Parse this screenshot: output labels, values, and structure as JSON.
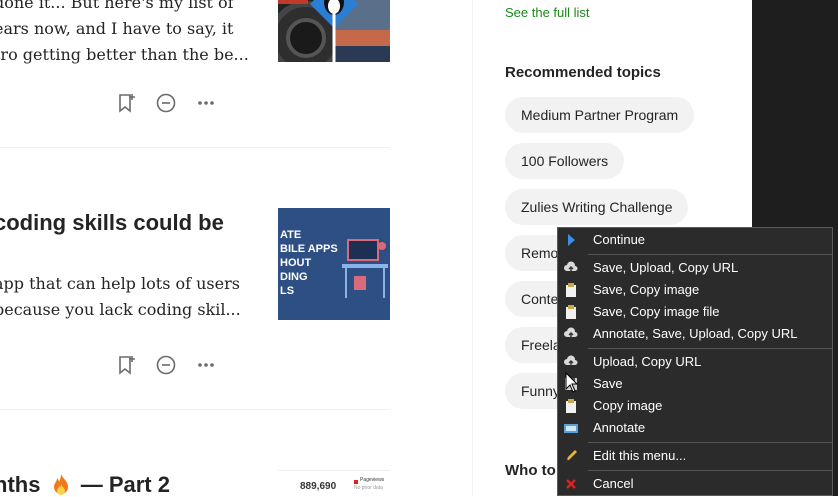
{
  "feed": {
    "article1": {
      "excerpt_lines": [
        "done it... But here's my list of",
        "ears now, and I have to say, it",
        "tro getting better than the be..."
      ]
    },
    "article2": {
      "title": "coding skills could be",
      "excerpt_lines": [
        "app that can help lots of users",
        "because you lack coding skil..."
      ],
      "thumb_lines": [
        "ATE",
        "BILE APPS",
        "HOUT",
        "DING",
        "LS"
      ]
    },
    "article3": {
      "title_prefix": "nths",
      "title_suffix": "— Part 2",
      "thumb_number": "889,690",
      "thumb_legend": "Pageviews",
      "thumb_legend_sub": "No prior data"
    }
  },
  "sidebar": {
    "see_full_list": "See the full list",
    "recommended_heading": "Recommended topics",
    "topics": [
      "Medium Partner Program",
      "100 Followers",
      "Zulies Writing Challenge",
      "Remo",
      "Conte",
      "Freela",
      "Funny"
    ],
    "who_to_follow_heading": "Who to"
  },
  "context_menu": {
    "items": [
      {
        "label": "Continue",
        "icon": "play-arrow-icon"
      },
      {
        "label": "Save, Upload, Copy URL",
        "icon": "cloud-upload-icon"
      },
      {
        "label": "Save, Copy image",
        "icon": "clipboard-icon"
      },
      {
        "label": "Save, Copy image file",
        "icon": "clipboard-icon"
      },
      {
        "label": "Annotate, Save, Upload, Copy URL",
        "icon": "cloud-upload-icon"
      },
      {
        "label": "Upload, Copy URL",
        "icon": "cloud-upload-icon"
      },
      {
        "label": "Save",
        "icon": "disk-icon"
      },
      {
        "label": "Copy image",
        "icon": "clipboard-icon"
      },
      {
        "label": "Annotate",
        "icon": "image-edit-icon"
      },
      {
        "label": "Edit this menu...",
        "icon": "pencil-icon"
      },
      {
        "label": "Cancel",
        "icon": "red-x-icon"
      }
    ]
  },
  "colors": {
    "accent_green": "#1a8917",
    "menu_bg": "#2b2b2b",
    "pill_bg": "#f2f2f2",
    "cancel_red": "#e02020"
  }
}
